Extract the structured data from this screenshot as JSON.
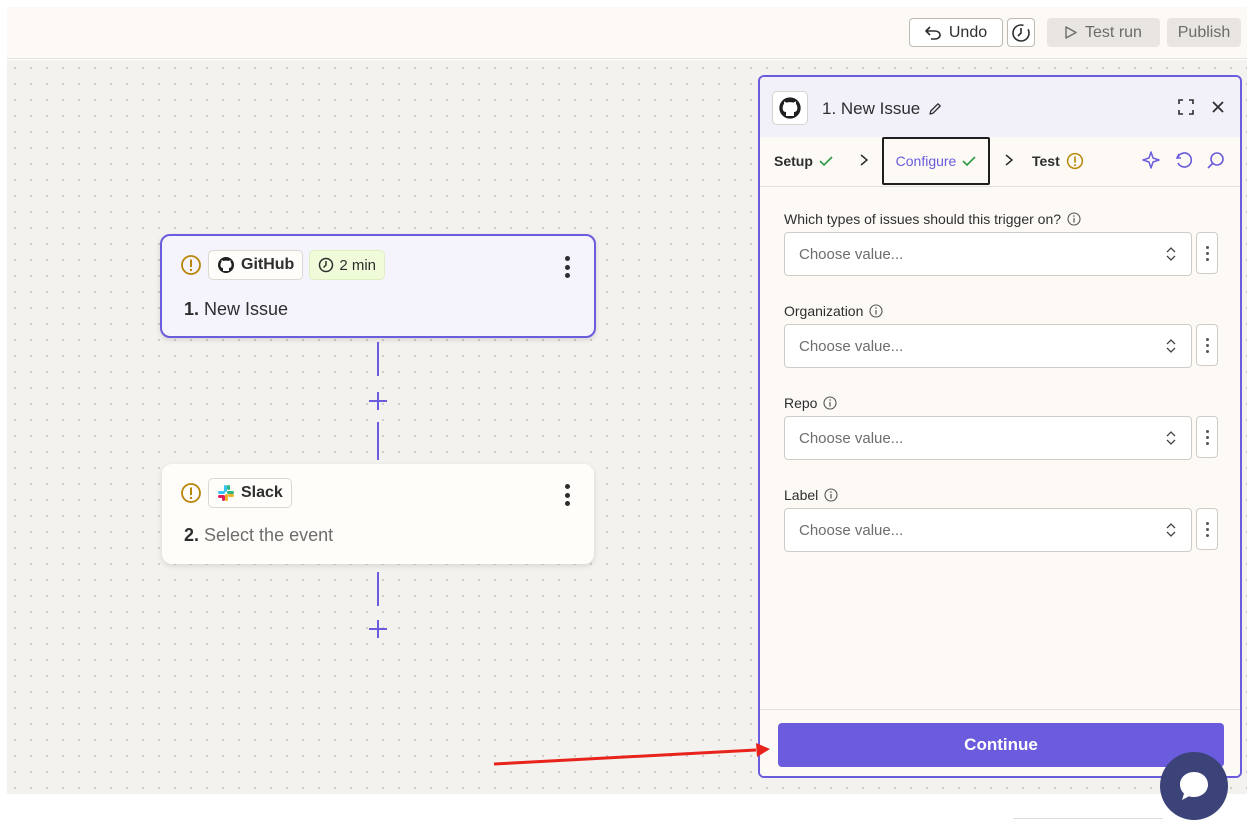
{
  "topbar": {
    "undo_label": "Undo",
    "test_run_label": "Test run",
    "publish_label": "Publish"
  },
  "canvas": {
    "steps": [
      {
        "app": "GitHub",
        "polling": "2 min",
        "number": "1.",
        "title": "New Issue"
      },
      {
        "app": "Slack",
        "number": "2.",
        "title": "Select the event"
      }
    ]
  },
  "panel": {
    "title": "1. New Issue",
    "tabs": [
      {
        "label": "Setup",
        "status": "complete"
      },
      {
        "label": "Configure",
        "status": "complete"
      },
      {
        "label": "Test",
        "status": "warning"
      }
    ],
    "fields": [
      {
        "label": "Which types of issues should this trigger on?",
        "placeholder": "Choose value..."
      },
      {
        "label": "Organization",
        "placeholder": "Choose value..."
      },
      {
        "label": "Repo",
        "placeholder": "Choose value..."
      },
      {
        "label": "Label",
        "placeholder": "Choose value..."
      }
    ],
    "continue_label": "Continue"
  },
  "colors": {
    "accent": "#6a5cdc",
    "warning": "#b8860b",
    "success": "#2e9a44",
    "annotation_arrow": "#e8231b",
    "chat_button": "#3b4378"
  }
}
